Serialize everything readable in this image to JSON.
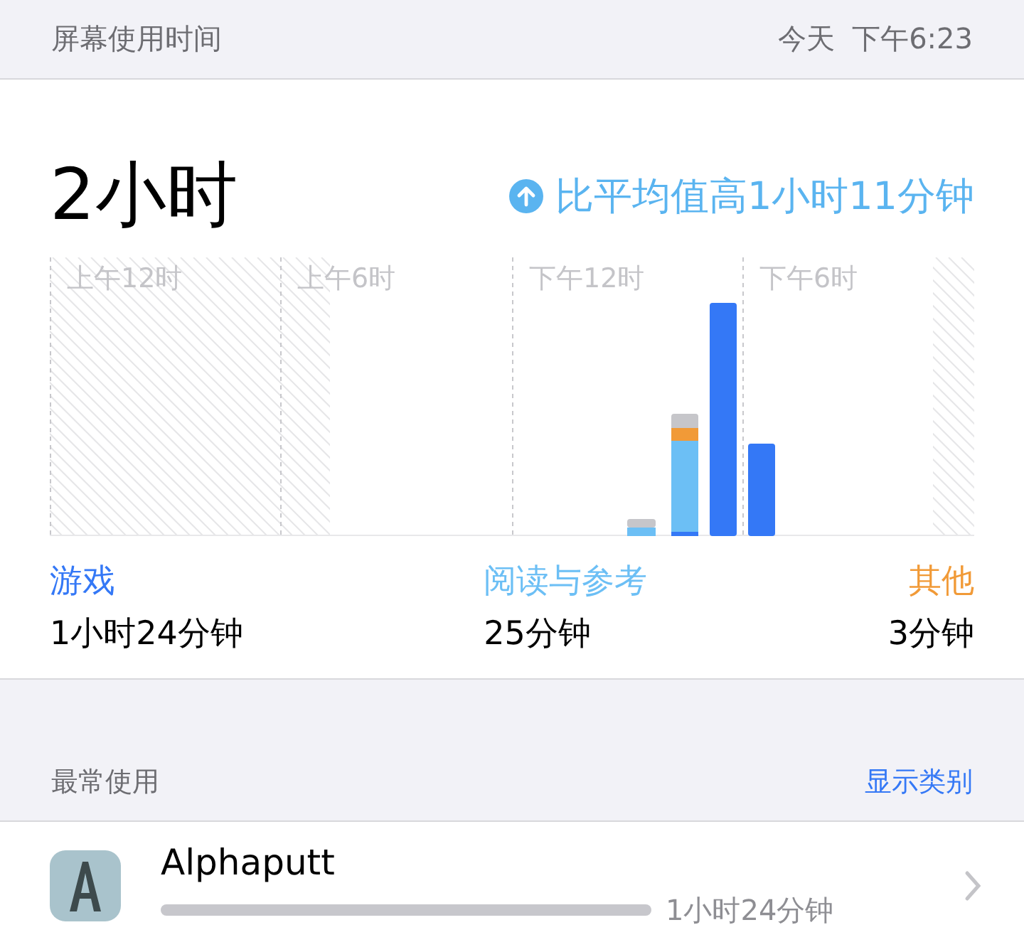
{
  "header": {
    "title": "屏幕使用时间",
    "date": "今天",
    "time": "下午6:23"
  },
  "summary": {
    "total": "2小时",
    "comparison": "比平均值高1小时11分钟"
  },
  "chart": {
    "axis_labels": [
      "上午12时",
      "上午6时",
      "下午12时",
      "下午6时"
    ]
  },
  "categories": [
    {
      "name": "游戏",
      "duration": "1小时24分钟",
      "color": "#3478f6"
    },
    {
      "name": "阅读与参考",
      "duration": "25分钟",
      "color": "#6cbff5"
    },
    {
      "name": "其他",
      "duration": "3分钟",
      "color": "#f19a37"
    }
  ],
  "most_used": {
    "title": "最常使用",
    "link": "显示类别",
    "apps": [
      {
        "name": "Alphaputt",
        "duration": "1小时24分钟",
        "level": 1
      }
    ]
  }
}
